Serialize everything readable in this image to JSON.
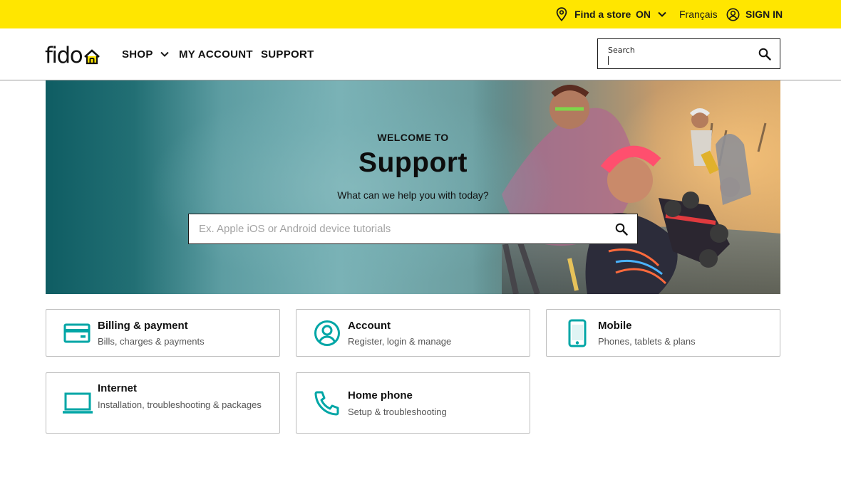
{
  "utility_bar": {
    "find_store": "Find a store",
    "province": "ON",
    "language": "Français",
    "sign_in": "SIGN IN"
  },
  "header": {
    "logo_text": "fido",
    "nav": {
      "shop": "SHOP",
      "my_account": "MY ACCOUNT",
      "support": "SUPPORT"
    },
    "search": {
      "label": "Search",
      "value": ""
    }
  },
  "hero": {
    "kicker": "WELCOME TO",
    "title": "Support",
    "subtitle": "What can we help you with today?",
    "search_placeholder": "Ex. Apple iOS or Android device tutorials"
  },
  "categories": [
    {
      "title": "Billing & payment",
      "description": "Bills, charges & payments",
      "icon": "credit-card-icon"
    },
    {
      "title": "Account",
      "description": "Register, login & manage",
      "icon": "user-circle-icon"
    },
    {
      "title": "Mobile",
      "description": "Phones, tablets & plans",
      "icon": "smartphone-icon"
    },
    {
      "title": "Internet",
      "description": "Installation, troubleshooting & packages",
      "icon": "laptop-icon"
    },
    {
      "title": "Home phone",
      "description": "Setup & troubleshooting",
      "icon": "phone-handset-icon"
    }
  ],
  "colors": {
    "brand_yellow": "#ffe600",
    "icon_teal": "#00a6a6",
    "hero_teal": "#0f5d63"
  }
}
